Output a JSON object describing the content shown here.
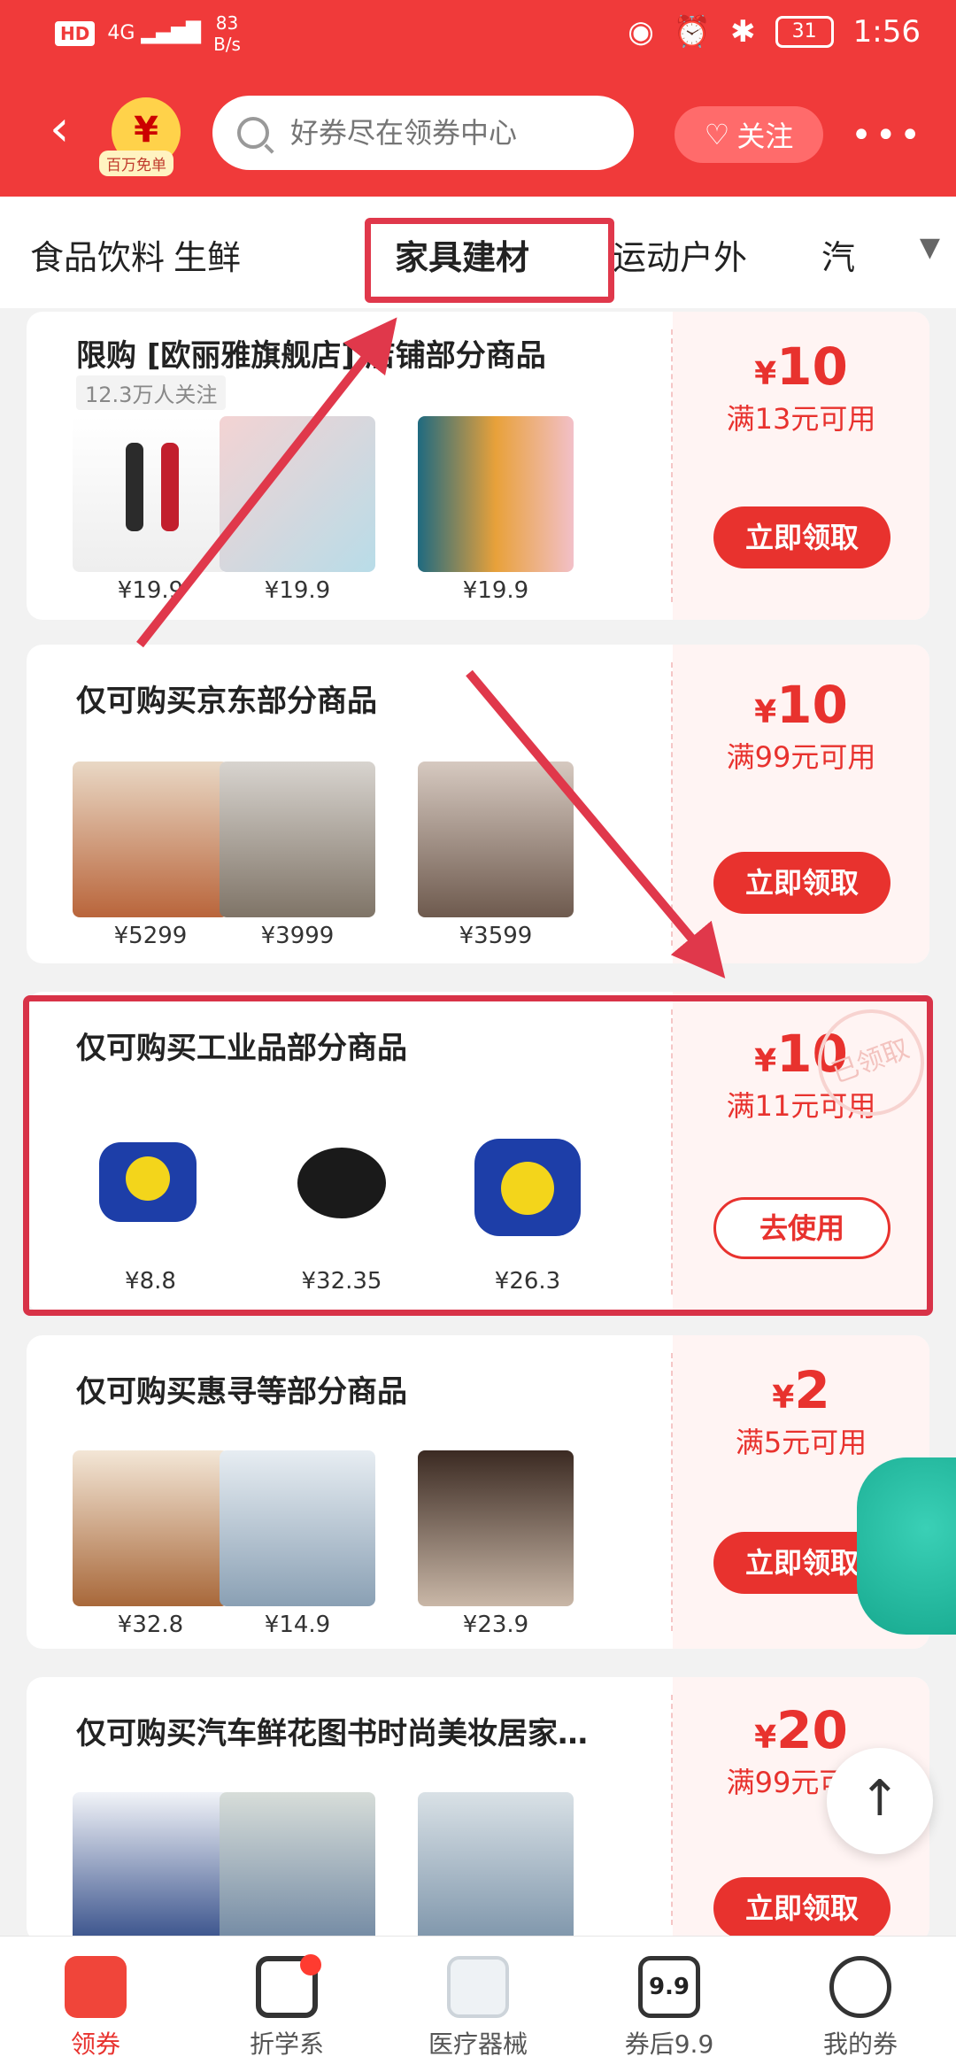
{
  "status": {
    "hd": "HD",
    "signal": "4G",
    "speed_value": "83",
    "speed_unit": "B/s",
    "battery": "31",
    "time": "1:56"
  },
  "nav": {
    "badge_label": "百万免单",
    "search_placeholder": "好券尽在领券中心",
    "follow_label": "关注",
    "more": "•••"
  },
  "categories": [
    "食品饮料",
    "生鲜",
    "家具建材",
    "运动户外",
    "汽"
  ],
  "coupons": [
    {
      "title": "限购 [欧丽雅旗舰店] 店铺部分商品",
      "followers": "12.3万人关注",
      "products": [
        {
          "price": "¥19.9"
        },
        {
          "price": "¥19.9"
        },
        {
          "price": "¥19.9"
        }
      ],
      "amount": "10",
      "currency": "¥",
      "condition": "满13元可用",
      "button": "立即领取"
    },
    {
      "title": "仅可购买京东部分商品",
      "products": [
        {
          "price": "¥5299"
        },
        {
          "price": "¥3999"
        },
        {
          "price": "¥3599"
        }
      ],
      "amount": "10",
      "currency": "¥",
      "condition": "满99元可用",
      "button": "立即领取"
    },
    {
      "title": "仅可购买工业品部分商品",
      "products": [
        {
          "price": "¥8.8"
        },
        {
          "price": "¥32.35"
        },
        {
          "price": "¥26.3"
        }
      ],
      "amount": "10",
      "currency": "¥",
      "condition": "满11元可用",
      "button": "去使用",
      "stamp": "已领取"
    },
    {
      "title": "仅可购买惠寻等部分商品",
      "products": [
        {
          "price": "¥32.8"
        },
        {
          "price": "¥14.9"
        },
        {
          "price": "¥23.9"
        }
      ],
      "amount": "2",
      "currency": "¥",
      "condition": "满5元可用",
      "button": "立即领取"
    },
    {
      "title": "仅可购买汽车鲜花图书时尚美妆居家…",
      "products": [
        {
          "price": ""
        },
        {
          "price": ""
        },
        {
          "price": ""
        }
      ],
      "amount": "20",
      "currency": "¥",
      "condition": "满99元可用",
      "button": "立即领取"
    }
  ],
  "tabs": [
    {
      "label": "领券",
      "icon": "coupon-icon"
    },
    {
      "label": "折学系",
      "icon": "z-icon"
    },
    {
      "label": "医疗器械",
      "icon": "device-icon"
    },
    {
      "label": "券后9.9",
      "icon": "price-9-9-icon",
      "icon_text": "9.9"
    },
    {
      "label": "我的券",
      "icon": "smile-icon"
    }
  ],
  "colors": {
    "brand_red": "#f03a3a",
    "accent_red": "#e8322e",
    "annotation_red": "#d83348"
  }
}
